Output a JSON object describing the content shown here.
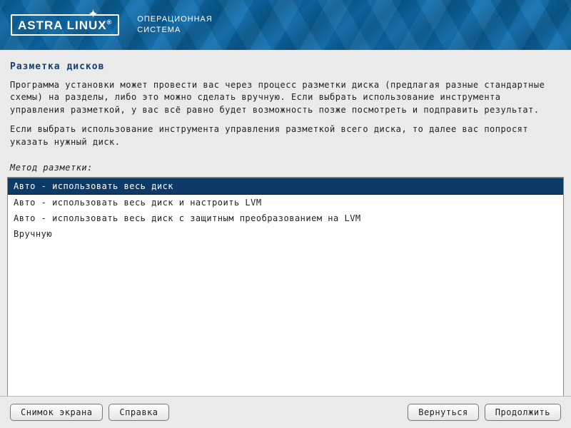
{
  "header": {
    "logo_text": "ASTRA LINUX",
    "logo_reg": "®",
    "subtitle_line1": "ОПЕРАЦИОННАЯ",
    "subtitle_line2": "СИСТЕМА"
  },
  "page": {
    "title": "Разметка дисков",
    "paragraph1": "Программа установки может провести вас через процесс разметки диска (предлагая разные стандартные схемы) на разделы, либо это можно сделать вручную. Если выбрать использование инструмента управления разметкой, у вас всё равно будет возможность позже посмотреть и подправить результат.",
    "paragraph2": "Если выбрать использование инструмента управления разметкой всего диска, то далее вас попросят указать нужный диск.",
    "method_label": "Метод разметки:"
  },
  "options": [
    "Авто - использовать весь диск",
    "Авто - использовать весь диск и настроить LVM",
    "Авто - использовать весь диск с защитным преобразованием на LVM",
    "Вручную"
  ],
  "selected_index": 0,
  "buttons": {
    "screenshot": "Снимок экрана",
    "help": "Справка",
    "back": "Вернуться",
    "continue": "Продолжить"
  }
}
